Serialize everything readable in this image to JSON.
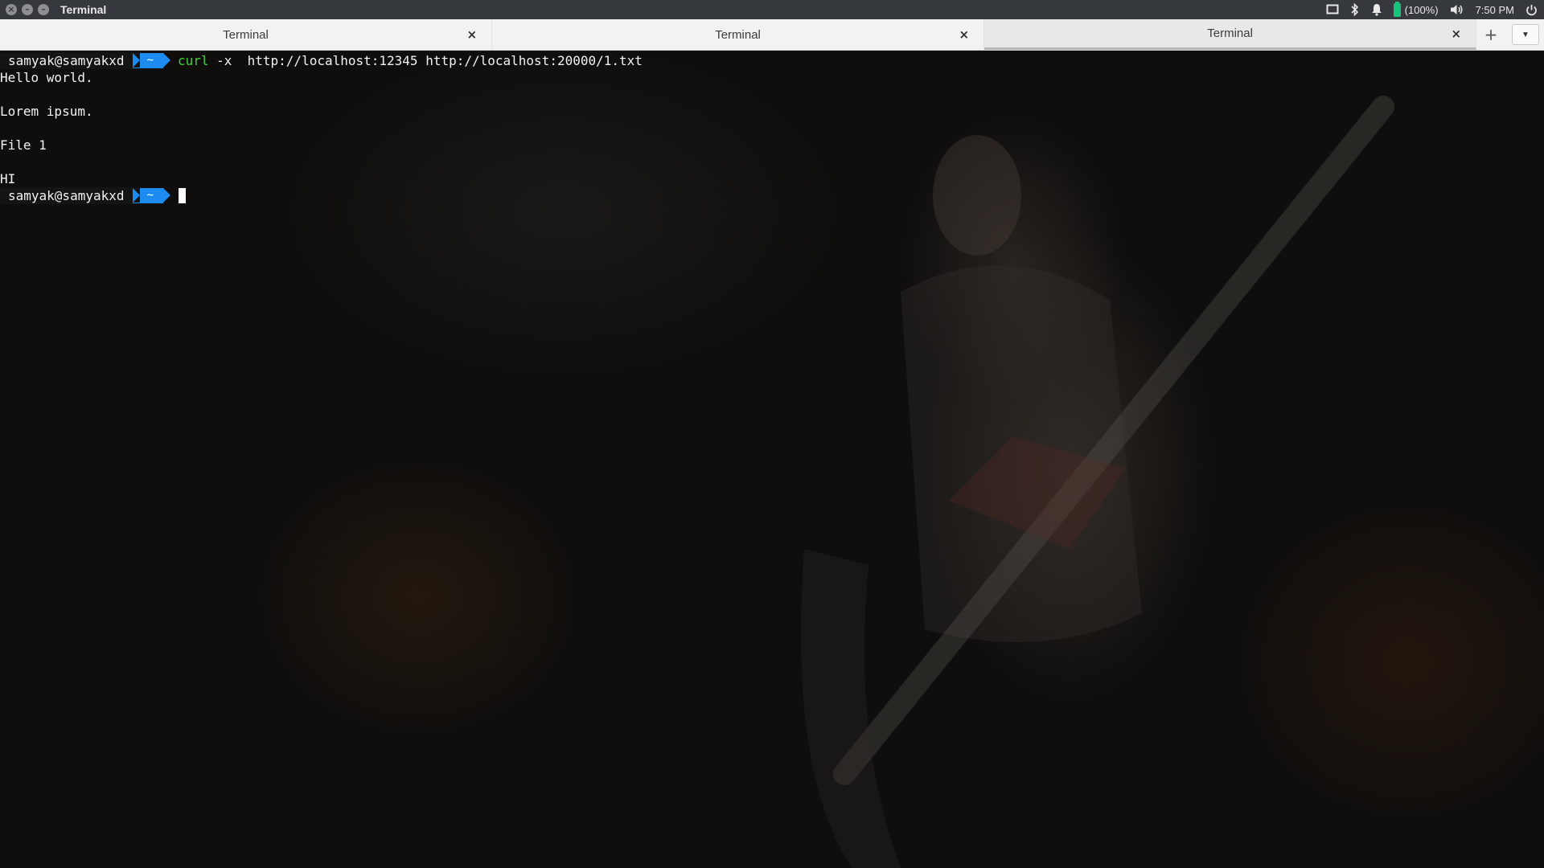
{
  "window": {
    "title": "Terminal",
    "controls": [
      "close-icon",
      "minimize-icon",
      "maximize-icon"
    ]
  },
  "tray": {
    "battery_text": "(100%)",
    "clock": "7:50 PM",
    "battery_color": "#18c37e",
    "icons": [
      "screen-icon",
      "bluetooth-icon",
      "bell-icon",
      "battery-icon",
      "volume-icon",
      "power-icon"
    ]
  },
  "tabs": [
    {
      "label": "Terminal",
      "active": false
    },
    {
      "label": "Terminal",
      "active": false
    },
    {
      "label": "Terminal",
      "active": true
    }
  ],
  "tab_controls": {
    "new_tab": "+",
    "close": "×",
    "menu": "▼"
  },
  "terminal": {
    "prompt_user": "samyak@samyakxd",
    "prompt_dir": "~",
    "command_name": "curl",
    "command_args": " -x  http://localhost:12345 http://localhost:20000/1.txt",
    "output": [
      "Hello world.",
      "",
      "Lorem ipsum.",
      "",
      "File 1",
      "",
      "HI"
    ],
    "prompt_color": "#1d8cf0",
    "command_color": "#3bd13b"
  }
}
